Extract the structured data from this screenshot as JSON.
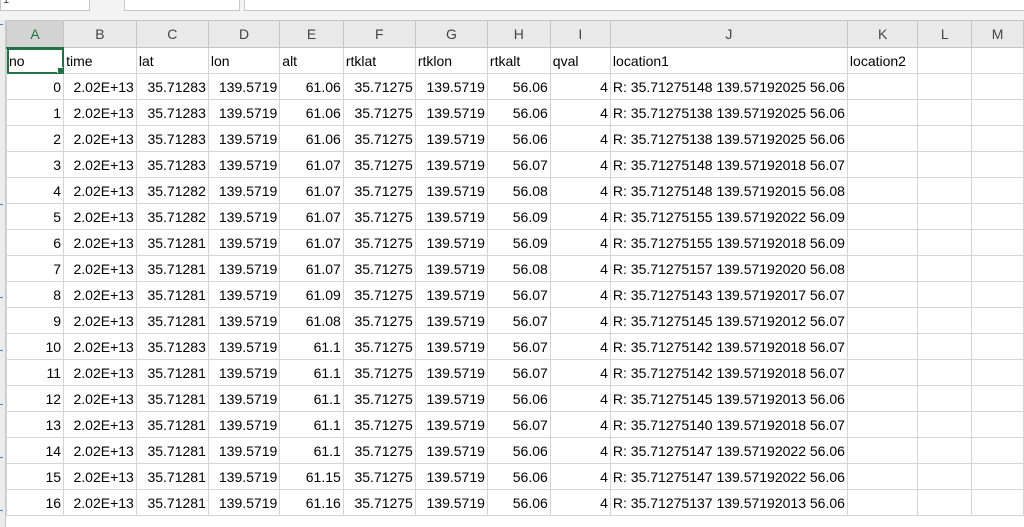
{
  "formula_bar": {
    "name_box": "1",
    "formula": ""
  },
  "columns": [
    "A",
    "B",
    "C",
    "D",
    "E",
    "F",
    "G",
    "H",
    "I",
    "J",
    "K",
    "L",
    "M"
  ],
  "active_column": "A",
  "header_row": {
    "no": "no",
    "time": "time",
    "lat": "lat",
    "lon": "lon",
    "alt": "alt",
    "rtklat": "rtklat",
    "rtklon": "rtklon",
    "rtkalt": "rtkalt",
    "qval": "qval",
    "location1": "location1",
    "location2": "location2"
  },
  "rows": [
    {
      "no": "0",
      "time": "2.02E+13",
      "lat": "35.71283",
      "lon": "139.5719",
      "alt": "61.06",
      "rtklat": "35.71275",
      "rtklon": "139.5719",
      "rtkalt": "56.06",
      "qval": "4",
      "location": "R: 35.71275148 139.57192025 56.06"
    },
    {
      "no": "1",
      "time": "2.02E+13",
      "lat": "35.71283",
      "lon": "139.5719",
      "alt": "61.06",
      "rtklat": "35.71275",
      "rtklon": "139.5719",
      "rtkalt": "56.06",
      "qval": "4",
      "location": "R: 35.71275138 139.57192025 56.06"
    },
    {
      "no": "2",
      "time": "2.02E+13",
      "lat": "35.71283",
      "lon": "139.5719",
      "alt": "61.06",
      "rtklat": "35.71275",
      "rtklon": "139.5719",
      "rtkalt": "56.06",
      "qval": "4",
      "location": "R: 35.71275138 139.57192025 56.06"
    },
    {
      "no": "3",
      "time": "2.02E+13",
      "lat": "35.71283",
      "lon": "139.5719",
      "alt": "61.07",
      "rtklat": "35.71275",
      "rtklon": "139.5719",
      "rtkalt": "56.07",
      "qval": "4",
      "location": "R: 35.71275148 139.57192018 56.07"
    },
    {
      "no": "4",
      "time": "2.02E+13",
      "lat": "35.71282",
      "lon": "139.5719",
      "alt": "61.07",
      "rtklat": "35.71275",
      "rtklon": "139.5719",
      "rtkalt": "56.08",
      "qval": "4",
      "location": "R: 35.71275148 139.57192015 56.08"
    },
    {
      "no": "5",
      "time": "2.02E+13",
      "lat": "35.71282",
      "lon": "139.5719",
      "alt": "61.07",
      "rtklat": "35.71275",
      "rtklon": "139.5719",
      "rtkalt": "56.09",
      "qval": "4",
      "location": "R: 35.71275155 139.57192022 56.09"
    },
    {
      "no": "6",
      "time": "2.02E+13",
      "lat": "35.71281",
      "lon": "139.5719",
      "alt": "61.07",
      "rtklat": "35.71275",
      "rtklon": "139.5719",
      "rtkalt": "56.09",
      "qval": "4",
      "location": "R: 35.71275155 139.57192018 56.09"
    },
    {
      "no": "7",
      "time": "2.02E+13",
      "lat": "35.71281",
      "lon": "139.5719",
      "alt": "61.07",
      "rtklat": "35.71275",
      "rtklon": "139.5719",
      "rtkalt": "56.08",
      "qval": "4",
      "location": "R: 35.71275157 139.57192020 56.08"
    },
    {
      "no": "8",
      "time": "2.02E+13",
      "lat": "35.71281",
      "lon": "139.5719",
      "alt": "61.09",
      "rtklat": "35.71275",
      "rtklon": "139.5719",
      "rtkalt": "56.07",
      "qval": "4",
      "location": "R: 35.71275143 139.57192017 56.07"
    },
    {
      "no": "9",
      "time": "2.02E+13",
      "lat": "35.71281",
      "lon": "139.5719",
      "alt": "61.08",
      "rtklat": "35.71275",
      "rtklon": "139.5719",
      "rtkalt": "56.07",
      "qval": "4",
      "location": "R: 35.71275145 139.57192012 56.07"
    },
    {
      "no": "10",
      "time": "2.02E+13",
      "lat": "35.71283",
      "lon": "139.5719",
      "alt": "61.1",
      "rtklat": "35.71275",
      "rtklon": "139.5719",
      "rtkalt": "56.07",
      "qval": "4",
      "location": "R: 35.71275142 139.57192018 56.07"
    },
    {
      "no": "11",
      "time": "2.02E+13",
      "lat": "35.71281",
      "lon": "139.5719",
      "alt": "61.1",
      "rtklat": "35.71275",
      "rtklon": "139.5719",
      "rtkalt": "56.07",
      "qval": "4",
      "location": "R: 35.71275142 139.57192018 56.07"
    },
    {
      "no": "12",
      "time": "2.02E+13",
      "lat": "35.71281",
      "lon": "139.5719",
      "alt": "61.1",
      "rtklat": "35.71275",
      "rtklon": "139.5719",
      "rtkalt": "56.06",
      "qval": "4",
      "location": "R: 35.71275145 139.57192013 56.06"
    },
    {
      "no": "13",
      "time": "2.02E+13",
      "lat": "35.71281",
      "lon": "139.5719",
      "alt": "61.1",
      "rtklat": "35.71275",
      "rtklon": "139.5719",
      "rtkalt": "56.07",
      "qval": "4",
      "location": "R: 35.71275140 139.57192018 56.07"
    },
    {
      "no": "14",
      "time": "2.02E+13",
      "lat": "35.71281",
      "lon": "139.5719",
      "alt": "61.1",
      "rtklat": "35.71275",
      "rtklon": "139.5719",
      "rtkalt": "56.06",
      "qval": "4",
      "location": "R: 35.71275147 139.57192022 56.06"
    },
    {
      "no": "15",
      "time": "2.02E+13",
      "lat": "35.71281",
      "lon": "139.5719",
      "alt": "61.15",
      "rtklat": "35.71275",
      "rtklon": "139.5719",
      "rtkalt": "56.06",
      "qval": "4",
      "location": "R: 35.71275147 139.57192022 56.06"
    },
    {
      "no": "16",
      "time": "2.02E+13",
      "lat": "35.71281",
      "lon": "139.5719",
      "alt": "61.16",
      "rtklat": "35.71275",
      "rtklon": "139.5719",
      "rtkalt": "56.06",
      "qval": "4",
      "location": "R: 35.71275137 139.57192013 56.06"
    }
  ]
}
